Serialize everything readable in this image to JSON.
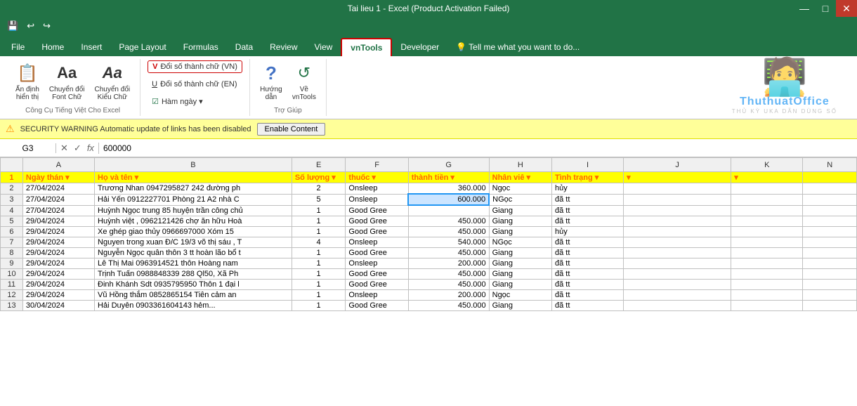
{
  "titleBar": {
    "title": "Tai lieu 1 - Excel (Product Activation Failed)",
    "controls": [
      "—",
      "□",
      "✕"
    ]
  },
  "ribbonTabs": [
    {
      "label": "File",
      "active": false
    },
    {
      "label": "Home",
      "active": false
    },
    {
      "label": "Insert",
      "active": false
    },
    {
      "label": "Page Layout",
      "active": false
    },
    {
      "label": "Formulas",
      "active": false
    },
    {
      "label": "Data",
      "active": false
    },
    {
      "label": "Review",
      "active": false
    },
    {
      "label": "View",
      "active": false
    },
    {
      "label": "vnTools",
      "active": true
    },
    {
      "label": "Developer",
      "active": false
    },
    {
      "label": "💡 Tell me what you want to do...",
      "active": false
    }
  ],
  "ribbon": {
    "groups": [
      {
        "label": "Công Cụ Tiếng Việt Cho Excel",
        "buttons_left": [
          {
            "label": "Ấn định\nhiển thị",
            "icon": "📋"
          },
          {
            "label": "Chuyển đổi\nFont Chữ",
            "icon": "Aa"
          },
          {
            "label": "Chuyển đổi\nKiểu Chữ",
            "icon": "Aa"
          }
        ],
        "buttons_right": [
          {
            "label": "V Đổi số thành chữ (VN)",
            "bordered": true
          },
          {
            "label": "U Đổi số thành chữ (EN)",
            "bordered": false
          },
          {
            "label": "☑ Hàm ngày ▾",
            "bordered": false
          }
        ]
      },
      {
        "label": "Trợ Giúp",
        "buttons": [
          {
            "label": "Hướng\ndẫn",
            "icon": "?"
          },
          {
            "label": "Về\nvnTools",
            "icon": "↺"
          }
        ]
      }
    ]
  },
  "quickAccess": {
    "buttons": [
      "💾",
      "↩",
      "↪"
    ]
  },
  "formulaBar": {
    "cellRef": "G3",
    "formulaValue": "600000",
    "icons": [
      "✕",
      "✓",
      "fx"
    ]
  },
  "security": {
    "icon": "⚠",
    "text": "SECURITY WARNING  Automatic update of links has been disabled",
    "buttonLabel": "Enable Content"
  },
  "columns": [
    {
      "label": "",
      "key": "row"
    },
    {
      "label": "A",
      "key": "a"
    },
    {
      "label": "B",
      "key": "b"
    },
    {
      "label": "E",
      "key": "e"
    },
    {
      "label": "F",
      "key": "f"
    },
    {
      "label": "G",
      "key": "g"
    },
    {
      "label": "H",
      "key": "h"
    },
    {
      "label": "I",
      "key": "i"
    },
    {
      "label": "J",
      "key": "j"
    },
    {
      "label": "K",
      "key": "k"
    },
    {
      "label": "N",
      "key": "n"
    }
  ],
  "headers": {
    "a": "Ngày thán ▾",
    "b": "Họ và tên ▾",
    "e": "Số lượng ▾",
    "f": "thuốc ▾",
    "g": "thành tiền ▾",
    "h": "Nhân viê ▾",
    "i": "Tình trạng ▾",
    "j": "▾",
    "k": "▾"
  },
  "rows": [
    {
      "row": 2,
      "a": "27/04/2024",
      "b": "Trương Nhan 0947295827 242 đường ph",
      "e": "2",
      "f": "Onsleep",
      "g": "360.000",
      "h": "Ngọc",
      "i": "hủy",
      "j": "",
      "k": ""
    },
    {
      "row": 3,
      "a": "27/04/2024",
      "b": "Hải Yến 0912227701 Phòng 21 A2 nhà C",
      "e": "5",
      "f": "Onsleep",
      "g": "600.000",
      "h": "NGọc",
      "i": "đã tt",
      "j": "",
      "k": ""
    },
    {
      "row": 4,
      "a": "27/04/2024",
      "b": "Huỳnh Ngọc trung 85 huyện trần công chủ",
      "e": "1",
      "f": "Good Gree",
      "g": "",
      "h": "Giang",
      "i": "đã tt",
      "j": "",
      "k": ""
    },
    {
      "row": 5,
      "a": "29/04/2024",
      "b": "Huỳnh việt , 0962121426 chợ ăn hữu Hoà",
      "e": "1",
      "f": "Good Gree",
      "g": "450.000",
      "h": "Giang",
      "i": "đã tt",
      "j": "",
      "k": ""
    },
    {
      "row": 6,
      "a": "29/04/2024",
      "b": "Xe ghép giao thủy 0966697000 Xóm 15",
      "e": "1",
      "f": "Good Gree",
      "g": "450.000",
      "h": "Giang",
      "i": "hủy",
      "j": "",
      "k": ""
    },
    {
      "row": 7,
      "a": "29/04/2024",
      "b": "Nguyen trong xuan Đ/C 19/3 võ thị sáu , T",
      "e": "4",
      "f": "Onsleep",
      "g": "540.000",
      "h": "NGọc",
      "i": "đã tt",
      "j": "",
      "k": ""
    },
    {
      "row": 8,
      "a": "29/04/2024",
      "b": "Nguyễn Ngọc quân thôn 3 tt hoàn lão bổ t",
      "e": "1",
      "f": "Good Gree",
      "g": "450.000",
      "h": "Giang",
      "i": "đã tt",
      "j": "",
      "k": ""
    },
    {
      "row": 9,
      "a": "29/04/2024",
      "b": "Lê Thị Mai 0963914521 thôn Hoàng nam",
      "e": "1",
      "f": "Onsleep",
      "g": "200.000",
      "h": "Giang",
      "i": "đã tt",
      "j": "",
      "k": ""
    },
    {
      "row": 10,
      "a": "29/04/2024",
      "b": "Trịnh Tuấn 0988848339 288 Ql50, Xã Ph",
      "e": "1",
      "f": "Good Gree",
      "g": "450.000",
      "h": "Giang",
      "i": "đã tt",
      "j": "",
      "k": ""
    },
    {
      "row": 11,
      "a": "29/04/2024",
      "b": "Đinh Khánh Sdt 0935795950 Thôn 1 đại l",
      "e": "1",
      "f": "Good Gree",
      "g": "450.000",
      "h": "Giang",
      "i": "đã tt",
      "j": "",
      "k": ""
    },
    {
      "row": 12,
      "a": "29/04/2024",
      "b": "Vũ Hồng thắm 0852865154 Tiên cảm an",
      "e": "1",
      "f": "Onsleep",
      "g": "200.000",
      "h": "Ngọc",
      "i": "đã tt",
      "j": "",
      "k": ""
    },
    {
      "row": 13,
      "a": "30/04/2024",
      "b": "Hải Duyên 0903361604143 hẻm...",
      "e": "1",
      "f": "Good Gree",
      "g": "450.000",
      "h": "Giang",
      "i": "đã tt",
      "j": "",
      "k": ""
    }
  ],
  "watermark": {
    "text": "ThuthuatOffice",
    "sub": "THỦ KỲ UKA DÃN DÙNG SỐ"
  }
}
